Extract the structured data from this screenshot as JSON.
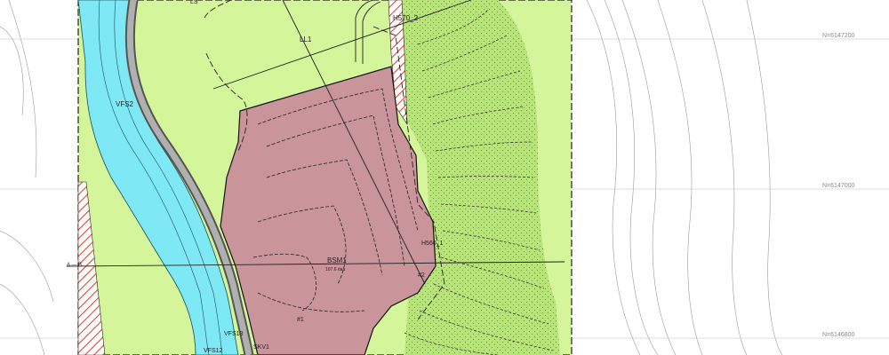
{
  "map": {
    "zones": {
      "ll1": "LL1",
      "bsm1": "BSM1",
      "bsm1_area": "107.6 daa",
      "vfs2": "VFS2",
      "vfs12": "VFS12",
      "vfs13": "VFS13",
      "skv1": "SKV1",
      "h570_2": "H570_2",
      "h560": "H560_1",
      "top_label": "LS"
    },
    "markers": {
      "m1": "#1",
      "m2": "#2"
    },
    "coordinates": {
      "n_top": "N=6147200",
      "n_mid": "N=6147000",
      "n_bot": "N=6146800"
    },
    "section_line": "A — B",
    "colors": {
      "agriculture": "#d4f59a",
      "steep_green": "#b6e276",
      "river": "#7fe8f5",
      "quarry": "#c9959a",
      "hatch": "#e0472f",
      "road": "#8a8a8a"
    }
  }
}
